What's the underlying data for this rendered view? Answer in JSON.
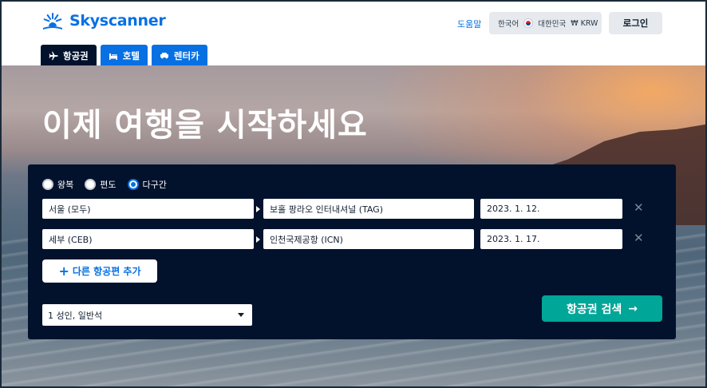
{
  "brand": {
    "name": "Skyscanner",
    "color": "#0770e3"
  },
  "header": {
    "help": "도움말",
    "locale": {
      "language": "한국어",
      "country": "대한민국",
      "currency": "₩ KRW"
    },
    "login": "로그인"
  },
  "tabs": [
    {
      "label": "항공권",
      "icon": "plane-icon",
      "active": true
    },
    {
      "label": "호텔",
      "icon": "bed-icon",
      "active": false
    },
    {
      "label": "렌터카",
      "icon": "car-icon",
      "active": false
    }
  ],
  "hero": {
    "title": "이제 여행을 시작하세요"
  },
  "search": {
    "trip_types": [
      {
        "label": "왕복",
        "checked": false
      },
      {
        "label": "편도",
        "checked": false
      },
      {
        "label": "다구간",
        "checked": true
      }
    ],
    "legs": [
      {
        "from": "서울 (모두)",
        "to": "보홀 팡라오 인터내셔널 (TAG)",
        "date": "2023. 1. 12."
      },
      {
        "from": "세부 (CEB)",
        "to": "인천국제공항 (ICN)",
        "date": "2023. 1. 17."
      }
    ],
    "add_flight": "다른 항공편 추가",
    "travellers": "1 성인, 일반석",
    "submit": "항공권 검색",
    "submit_color": "#00a698"
  }
}
